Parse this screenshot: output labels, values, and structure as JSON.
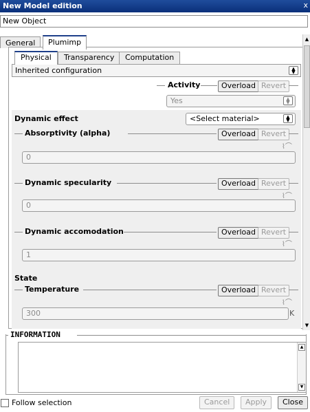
{
  "window": {
    "title": "New Model edition",
    "close_glyph": "x"
  },
  "object_name": "New Object",
  "tabs": [
    {
      "label": "General"
    },
    {
      "label": "Plumimp"
    }
  ],
  "subtabs": [
    {
      "label": "Physical"
    },
    {
      "label": "Transparency"
    },
    {
      "label": "Computation"
    }
  ],
  "configuration": {
    "value": "Inherited configuration"
  },
  "activity": {
    "label": "Activity",
    "value": "Yes"
  },
  "dynamic_effect": {
    "label": "Dynamic effect",
    "material_select": "<Select material>"
  },
  "properties": [
    {
      "label": "Absorptivity (alpha)",
      "value": "0"
    },
    {
      "label": "Dynamic specularity",
      "value": "0"
    },
    {
      "label": "Dynamic accomodation",
      "value": "1"
    }
  ],
  "state": {
    "label": "State",
    "temperature_label": "Temperature",
    "temperature_value": "300",
    "temperature_unit": "K"
  },
  "buttons": {
    "overload": "Overload",
    "revert": "Revert"
  },
  "information": {
    "title": "INFORMATION"
  },
  "footer": {
    "follow_selection": "Follow selection",
    "cancel": "Cancel",
    "apply": "Apply",
    "close": "Close"
  },
  "icons": {
    "graph": "graph-icon",
    "spin": "spin-arrows-icon"
  }
}
